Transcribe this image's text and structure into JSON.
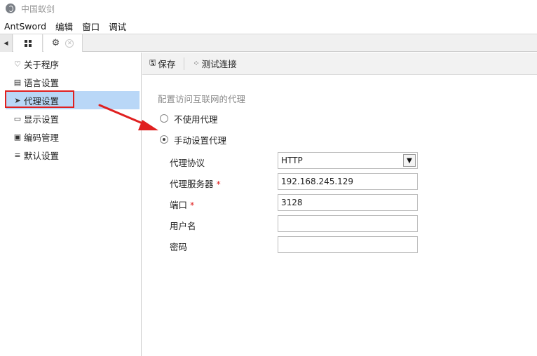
{
  "window": {
    "title": "中国蚁剑"
  },
  "menubar": {
    "items": [
      "AntSword",
      "编辑",
      "窗口",
      "调试"
    ]
  },
  "tabs": {
    "scroll_left": "◀"
  },
  "sidebar": {
    "items": [
      {
        "icon": "heart-icon",
        "glyph": "♡",
        "label": "关于程序"
      },
      {
        "icon": "language-icon",
        "glyph": "▤",
        "label": "语言设置"
      },
      {
        "icon": "paper-plane-icon",
        "glyph": "➤",
        "label": "代理设置",
        "selected": true
      },
      {
        "icon": "monitor-icon",
        "glyph": "▭",
        "label": "显示设置"
      },
      {
        "icon": "encoding-icon",
        "glyph": "▣",
        "label": "编码管理"
      },
      {
        "icon": "sliders-icon",
        "glyph": "≡",
        "label": "默认设置"
      }
    ]
  },
  "toolbar": {
    "save_label": "保存",
    "test_label": "测试连接"
  },
  "proxy": {
    "section_title": "配置访问互联网的代理",
    "option_none": "不使用代理",
    "option_manual": "手动设置代理",
    "selected_option": "manual",
    "protocol_label": "代理协议",
    "protocol_value": "HTTP",
    "server_label": "代理服务器",
    "server_value": "192.168.245.129",
    "port_label": "端口",
    "port_value": "3128",
    "username_label": "用户名",
    "username_value": "",
    "password_label": "密码",
    "password_value": "",
    "required_mark": "*"
  },
  "colors": {
    "selected_bg": "#b9d7f7",
    "annotation_red": "#e02020"
  }
}
